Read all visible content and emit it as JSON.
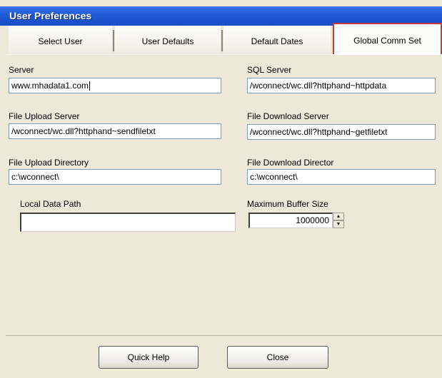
{
  "window": {
    "title": "User Preferences"
  },
  "tabs": [
    {
      "label": "Select User"
    },
    {
      "label": "User Defaults"
    },
    {
      "label": "Default Dates"
    },
    {
      "label": "Global Comm Set"
    }
  ],
  "form": {
    "server": {
      "label": "Server",
      "value": "www.mhadata1.com"
    },
    "sql_server": {
      "label": "SQL Server",
      "value": "/wconnect/wc.dll?httphand~httpdata"
    },
    "file_upload_server": {
      "label": "File Upload Server",
      "value": "/wconnect/wc.dll?httphand~sendfiletxt"
    },
    "file_download_server": {
      "label": "File Download Server",
      "value": "/wconnect/wc.dll?httphand~getfiletxt"
    },
    "file_upload_directory": {
      "label": "File Upload Directory",
      "value": "c:\\wconnect\\"
    },
    "file_download_director": {
      "label": "File Download Director",
      "value": "c:\\wconnect\\"
    },
    "local_data_path": {
      "label": "Local Data Path",
      "value": ""
    },
    "maximum_buffer_size": {
      "label": "Maximum Buffer Size",
      "value": "1000000"
    }
  },
  "buttons": {
    "quick_help": "Quick Help",
    "close": "Close"
  },
  "icons": {
    "spin_up": "▲",
    "spin_down": "▼"
  }
}
